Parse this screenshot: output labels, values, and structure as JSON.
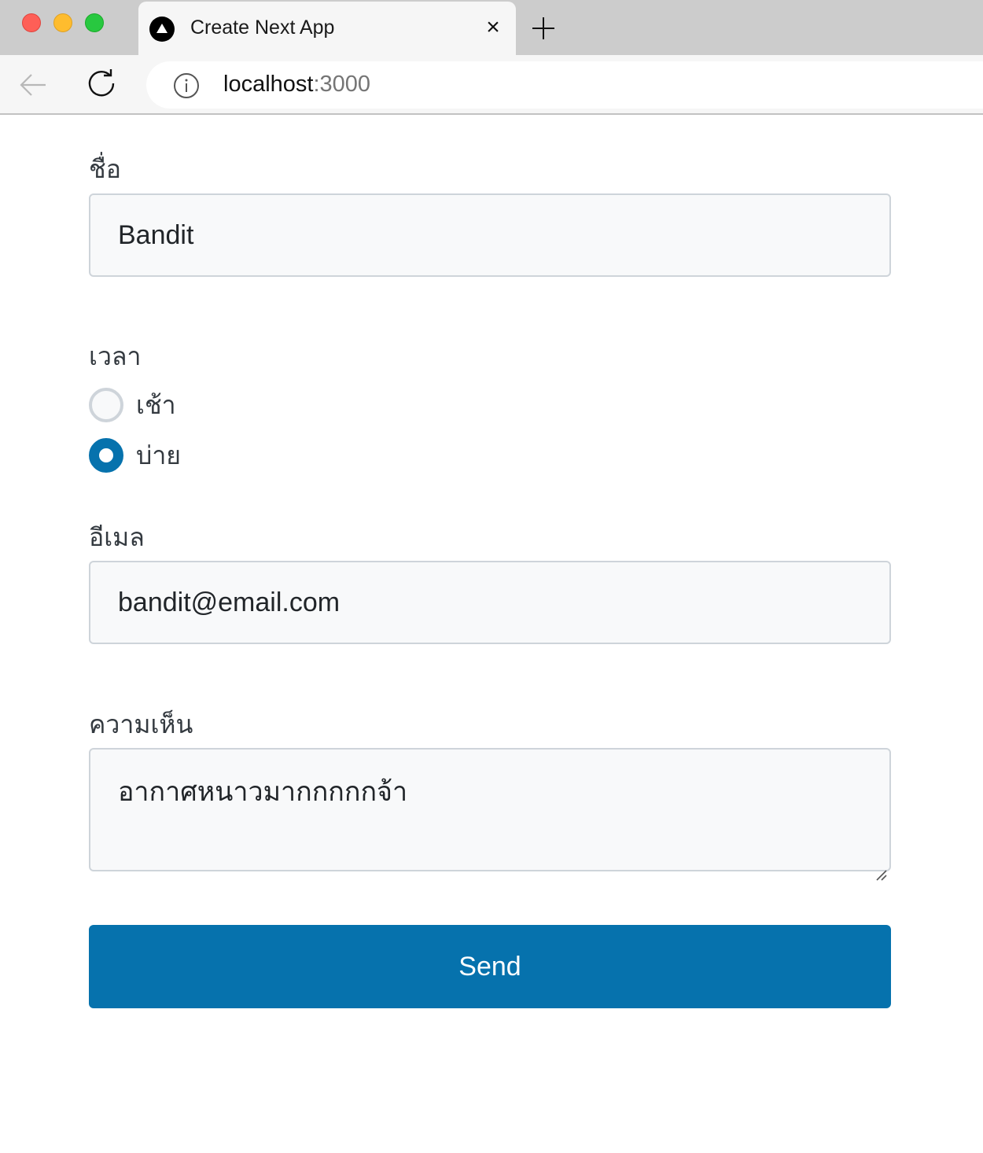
{
  "browser": {
    "tab": {
      "title": "Create Next App",
      "favicon": "nextjs-triangle-icon",
      "close_glyph": "×"
    },
    "new_tab_icon": "plus-icon",
    "nav": {
      "back_icon": "arrow-left-icon",
      "reload_icon": "reload-icon"
    },
    "address": {
      "info_icon": "info-icon",
      "host": "localhost",
      "port": ":3000"
    }
  },
  "form": {
    "name": {
      "label": "ชื่อ",
      "value": "Bandit"
    },
    "time": {
      "label": "เวลา",
      "options": [
        {
          "label": "เช้า",
          "selected": false
        },
        {
          "label": "บ่าย",
          "selected": true
        }
      ]
    },
    "email": {
      "label": "อีเมล",
      "value": "bandit@email.com"
    },
    "comment": {
      "label": "ความเห็น",
      "value": "อากาศหนาวมากกกกกจ้า"
    },
    "submit_label": "Send"
  },
  "colors": {
    "accent": "#0672ad",
    "field_bg": "#f8f9fa",
    "field_border": "#ced4da"
  }
}
